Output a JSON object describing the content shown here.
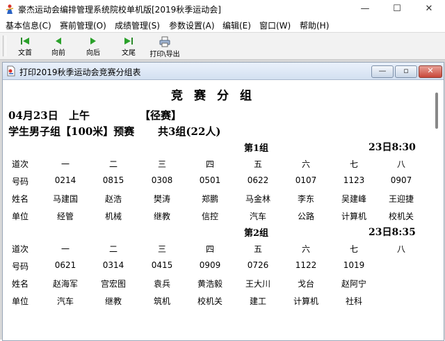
{
  "window": {
    "title": "豪杰运动会编排管理系统院校单机版[2019秋季运动会]",
    "min_glyph": "—",
    "max_glyph": "☐",
    "close_glyph": "✕"
  },
  "menu": {
    "items": [
      {
        "label": "基本信息(C)"
      },
      {
        "label": "赛前管理(O)"
      },
      {
        "label": "成绩管理(S)"
      },
      {
        "label": "参数设置(A)"
      },
      {
        "label": "编辑(E)"
      },
      {
        "label": "窗口(W)"
      },
      {
        "label": "帮助(H)"
      }
    ]
  },
  "toolbar": {
    "first": "文首",
    "prev": "向前",
    "next": "向后",
    "last": "文尾",
    "print": "打印\\导出"
  },
  "child": {
    "title": "打印2019秋季运动会竞赛分组表",
    "min_glyph": "—",
    "max_glyph": "▫",
    "close_glyph": "✕"
  },
  "report": {
    "title": "竞赛分组",
    "date": "04月23日",
    "session": "上午",
    "category": "【径赛】",
    "event_line": "学生男子组【100米】预赛",
    "groups_summary": "共3组(22人)",
    "row_labels": {
      "lane": "道次",
      "number": "号码",
      "name": "姓名",
      "unit": "单位"
    },
    "lanes": [
      "一",
      "二",
      "三",
      "四",
      "五",
      "六",
      "七",
      "八"
    ],
    "groups": [
      {
        "title": "第1组",
        "time": "23日8:30",
        "numbers": [
          "0214",
          "0815",
          "0308",
          "0501",
          "0622",
          "0107",
          "1123",
          "0907"
        ],
        "names": [
          "马建国",
          "赵浩",
          "樊涛",
          "郑鹏",
          "马金林",
          "李东",
          "吴建峰",
          "王迎捷"
        ],
        "units": [
          "经管",
          "机械",
          "继教",
          "信控",
          "汽车",
          "公路",
          "计算机",
          "校机关"
        ]
      },
      {
        "title": "第2组",
        "time": "23日8:35",
        "numbers": [
          "0621",
          "0314",
          "0415",
          "0909",
          "0726",
          "1122",
          "1019",
          ""
        ],
        "names": [
          "赵海军",
          "宫宏图",
          "袁兵",
          "黄浩毅",
          "王大川",
          "戈台",
          "赵阿宁",
          ""
        ],
        "units": [
          "汽车",
          "继教",
          "筑机",
          "校机关",
          "建工",
          "计算机",
          "社科",
          ""
        ]
      }
    ]
  }
}
